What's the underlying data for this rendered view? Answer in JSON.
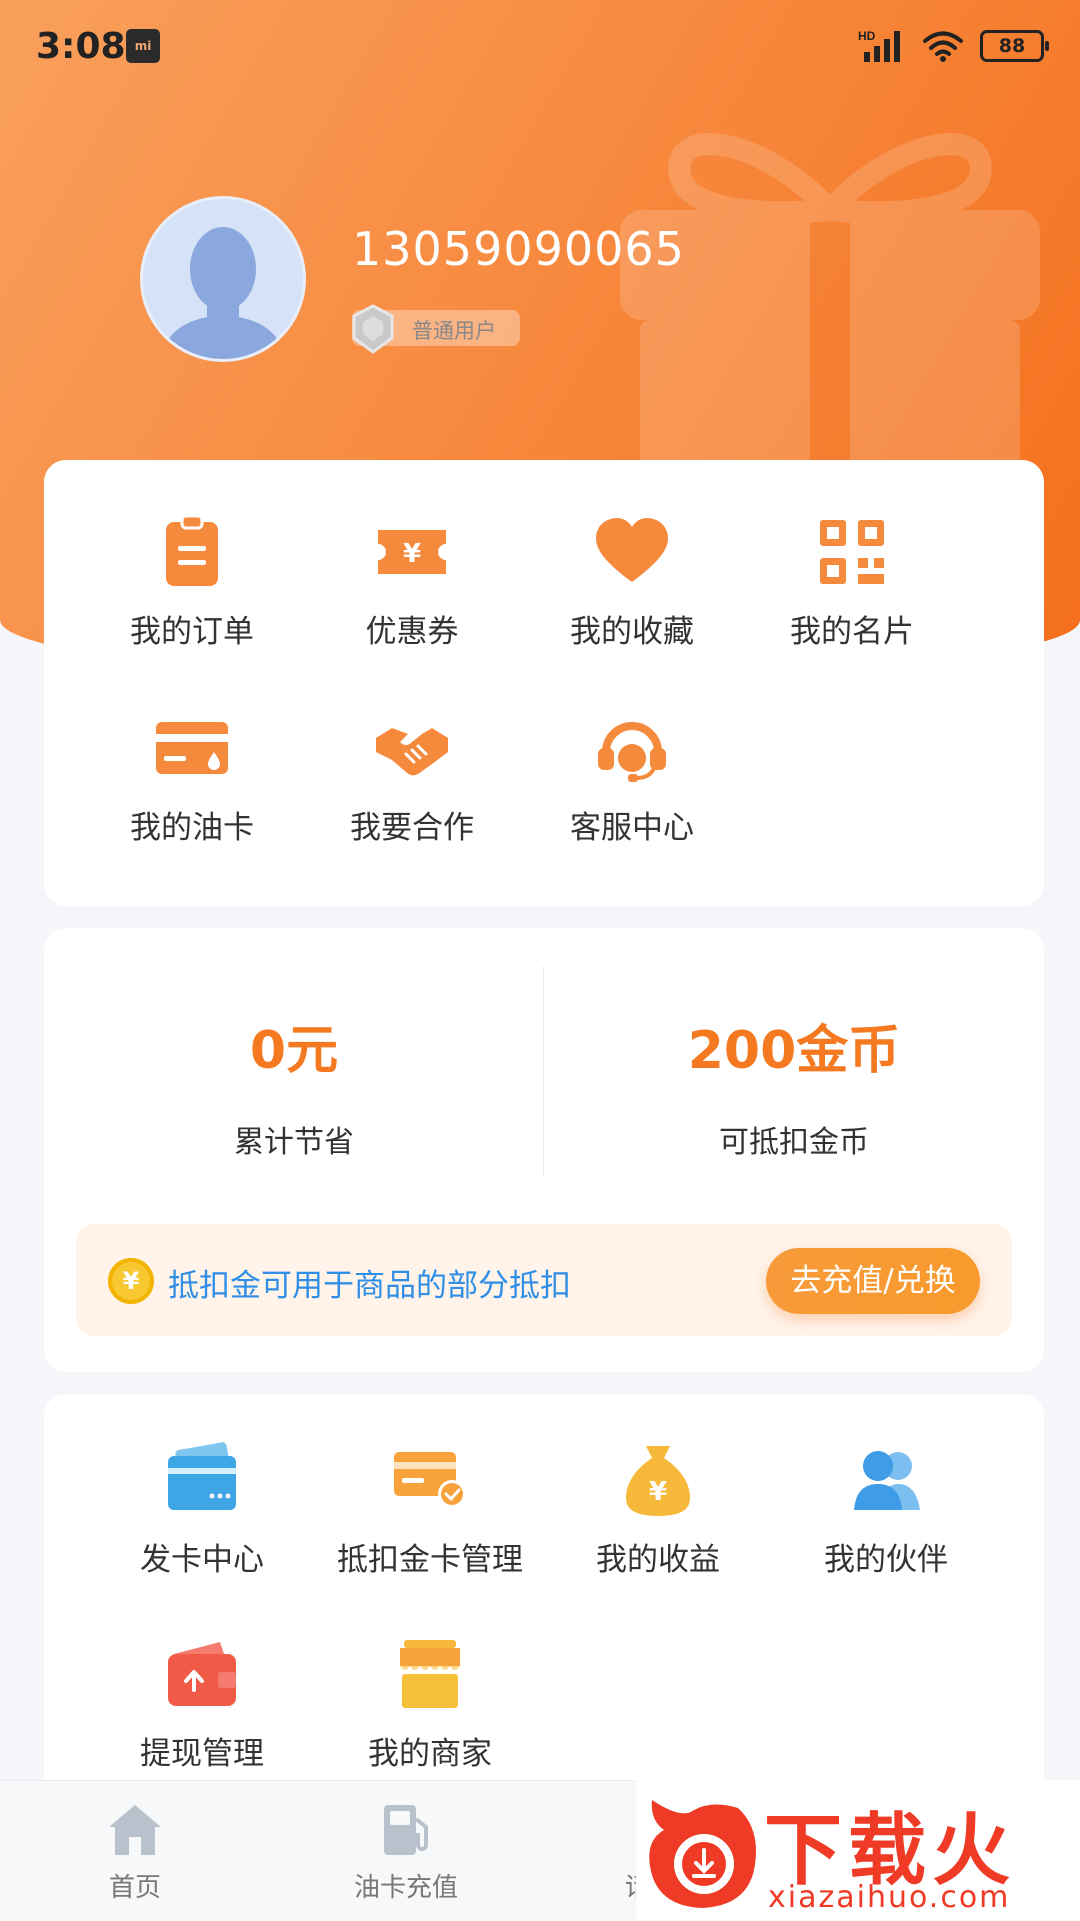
{
  "status_bar": {
    "time": "3:08",
    "network": "HD",
    "battery": "88"
  },
  "profile": {
    "phone": "13059090065",
    "badge": "普通用户"
  },
  "menu_primary": [
    {
      "label": "我的订单",
      "icon": "clipboard-icon"
    },
    {
      "label": "优惠券",
      "icon": "coupon-icon"
    },
    {
      "label": "我的收藏",
      "icon": "heart-icon"
    },
    {
      "label": "我的名片",
      "icon": "qrcode-icon"
    },
    {
      "label": "我的油卡",
      "icon": "fuel-card-icon"
    },
    {
      "label": "我要合作",
      "icon": "handshake-icon"
    },
    {
      "label": "客服中心",
      "icon": "headset-icon"
    }
  ],
  "stats": {
    "saved_value": "0元",
    "saved_label": "累计节省",
    "coins_value": "200金币",
    "coins_label": "可抵扣金币"
  },
  "promo": {
    "coin_symbol": "¥",
    "text": "抵扣金可用于商品的部分抵扣",
    "button": "去充值/兑换"
  },
  "menu_secondary": [
    {
      "label": "发卡中心",
      "icon": "card-icon"
    },
    {
      "label": "抵扣金卡管理",
      "icon": "card-check-icon"
    },
    {
      "label": "我的收益",
      "icon": "money-bag-icon"
    },
    {
      "label": "我的伙伴",
      "icon": "users-icon"
    },
    {
      "label": "提现管理",
      "icon": "wallet-icon"
    },
    {
      "label": "我的商家",
      "icon": "shop-icon"
    }
  ],
  "tabbar": [
    {
      "label": "首页",
      "icon": "home-icon"
    },
    {
      "label": "油卡充值",
      "icon": "fuel-pump-icon"
    },
    {
      "label": "话费充值",
      "icon": "phone-icon"
    }
  ],
  "watermark": {
    "big": "下载火",
    "small": "xiazaihuo.com"
  },
  "colors": {
    "accent": "#f47920",
    "hero_start": "#f9a05c",
    "hero_end": "#f46f1c",
    "link_blue": "#2f8ee6"
  }
}
